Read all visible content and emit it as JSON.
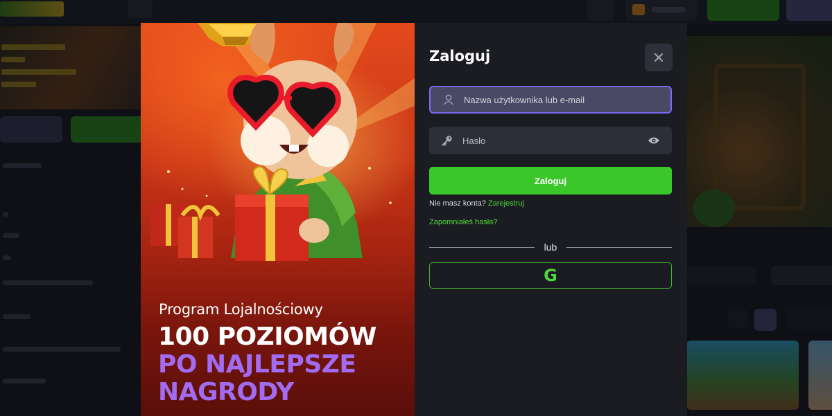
{
  "modal": {
    "promo": {
      "subtitle": "Program Lojalnościowy",
      "title_line1": "100 POZIOMÓW",
      "title_line2": "PO NAJLEPSZE",
      "title_line3": "NAGRODY"
    },
    "form": {
      "title": "Zaloguj",
      "close_icon": "close-icon",
      "username_placeholder": "Nazwa użytkownika lub e-mail",
      "password_placeholder": "Hasło",
      "login_button": "Zaloguj",
      "no_account_text": "Nie masz konta?",
      "register_link": "Zarejestruj",
      "forgot_link": "Zapomniałeś hasła?",
      "divider_text": "lub",
      "google_button_letter": "G"
    }
  },
  "colors": {
    "accent_green": "#3bc72a",
    "accent_purple": "#a26cf2",
    "modal_bg": "#1a1c21",
    "input_focus_border": "#7a6cf0"
  }
}
